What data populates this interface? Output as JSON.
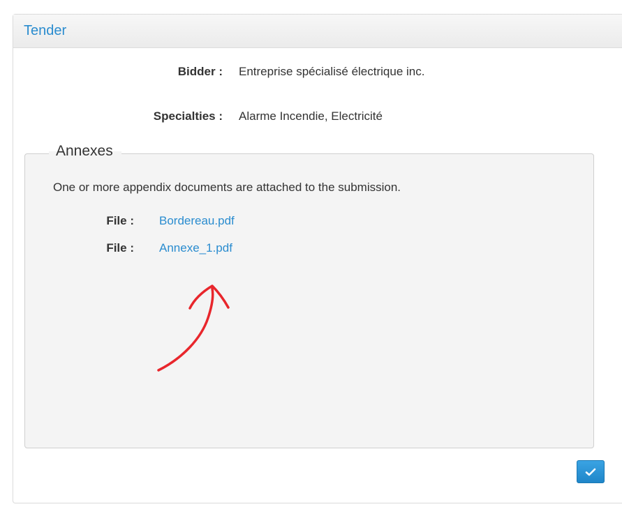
{
  "panel": {
    "title": "Tender"
  },
  "details": {
    "bidder_label": "Bidder :",
    "bidder_value": "Entreprise spécialisé électrique inc.",
    "specialties_label": "Specialties :",
    "specialties_value": "Alarme Incendie, Electricité"
  },
  "annexes": {
    "legend": "Annexes",
    "description": "One or more appendix documents are attached to the submission.",
    "files": [
      {
        "label": "File :",
        "name": "Bordereau.pdf"
      },
      {
        "label": "File :",
        "name": "Annexe_1.pdf"
      }
    ]
  },
  "annotation": {
    "icon": "red-hand-drawn-arrow-icon",
    "color": "#e8262c"
  },
  "footer": {
    "confirm_icon": "checkmark-icon",
    "accent_color": "#2a8ccf"
  }
}
